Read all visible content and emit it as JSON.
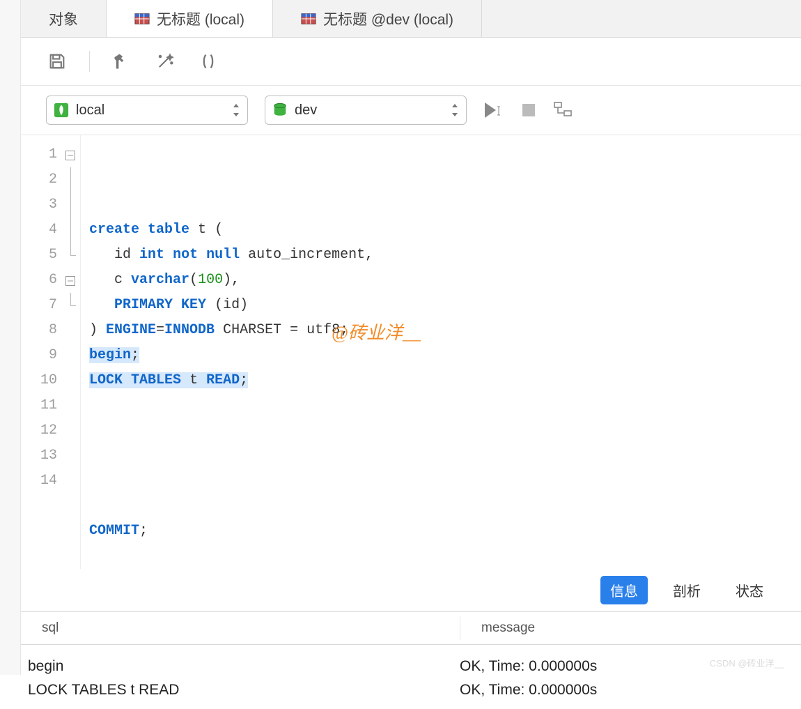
{
  "tabs": [
    {
      "label": "对象"
    },
    {
      "label": "无标题 (local)"
    },
    {
      "label": "无标题 @dev (local)"
    }
  ],
  "activeTabIndex": 1,
  "selectors": {
    "connection": "local",
    "database": "dev"
  },
  "editor": {
    "lines": [
      "1",
      "2",
      "3",
      "4",
      "5",
      "6",
      "7",
      "8",
      "9",
      "10",
      "11",
      "12",
      "13",
      "14"
    ],
    "code_tokens": [
      [
        [
          "kw",
          "create"
        ],
        [
          "sp",
          " "
        ],
        [
          "kw",
          "table"
        ],
        [
          "sp",
          " "
        ],
        [
          "txt",
          "t ("
        ]
      ],
      [
        [
          "sp",
          "   "
        ],
        [
          "txt",
          "id "
        ],
        [
          "kw",
          "int"
        ],
        [
          "sp",
          " "
        ],
        [
          "kw",
          "not"
        ],
        [
          "sp",
          " "
        ],
        [
          "kw",
          "null"
        ],
        [
          "sp",
          " "
        ],
        [
          "txt",
          "auto_increment,"
        ]
      ],
      [
        [
          "sp",
          "   "
        ],
        [
          "txt",
          "c "
        ],
        [
          "kw",
          "varchar"
        ],
        [
          "txt",
          "("
        ],
        [
          "num",
          "100"
        ],
        [
          "txt",
          ")"
        ],
        [
          "txt",
          ","
        ]
      ],
      [
        [
          "sp",
          "   "
        ],
        [
          "kw",
          "PRIMARY"
        ],
        [
          "sp",
          " "
        ],
        [
          "kw",
          "KEY"
        ],
        [
          "sp",
          " "
        ],
        [
          "txt",
          "(id)"
        ]
      ],
      [
        [
          "txt",
          ") "
        ],
        [
          "kw",
          "ENGINE"
        ],
        [
          "txt",
          "="
        ],
        [
          "kw",
          "INNODB"
        ],
        [
          "sp",
          " "
        ],
        [
          "txt",
          "CHARSET = utf8;"
        ]
      ],
      [
        [
          "selkw",
          "begin"
        ],
        [
          "seltxt",
          ";"
        ]
      ],
      [
        [
          "selkw",
          "LOCK"
        ],
        [
          "selsp",
          " "
        ],
        [
          "selkw",
          "TABLES"
        ],
        [
          "selsp",
          " "
        ],
        [
          "seltxt",
          "t "
        ],
        [
          "selkw",
          "READ"
        ],
        [
          "seltxt",
          ";"
        ]
      ],
      [],
      [],
      [],
      [],
      [],
      [
        [
          "kw",
          "COMMIT"
        ],
        [
          "txt",
          ";"
        ]
      ],
      []
    ],
    "watermark": "@砖业洋__"
  },
  "resultTabs": {
    "items": [
      "信息",
      "剖析",
      "状态"
    ],
    "activeIndex": 0
  },
  "resultTable": {
    "headers": {
      "sql": "sql",
      "message": "message"
    },
    "rows": [
      {
        "sql": "begin",
        "message": "OK, Time: 0.000000s"
      },
      {
        "sql": "LOCK TABLES t READ",
        "message": "OK, Time: 0.000000s"
      }
    ]
  },
  "footer_watermark": "CSDN @砖业洋__"
}
